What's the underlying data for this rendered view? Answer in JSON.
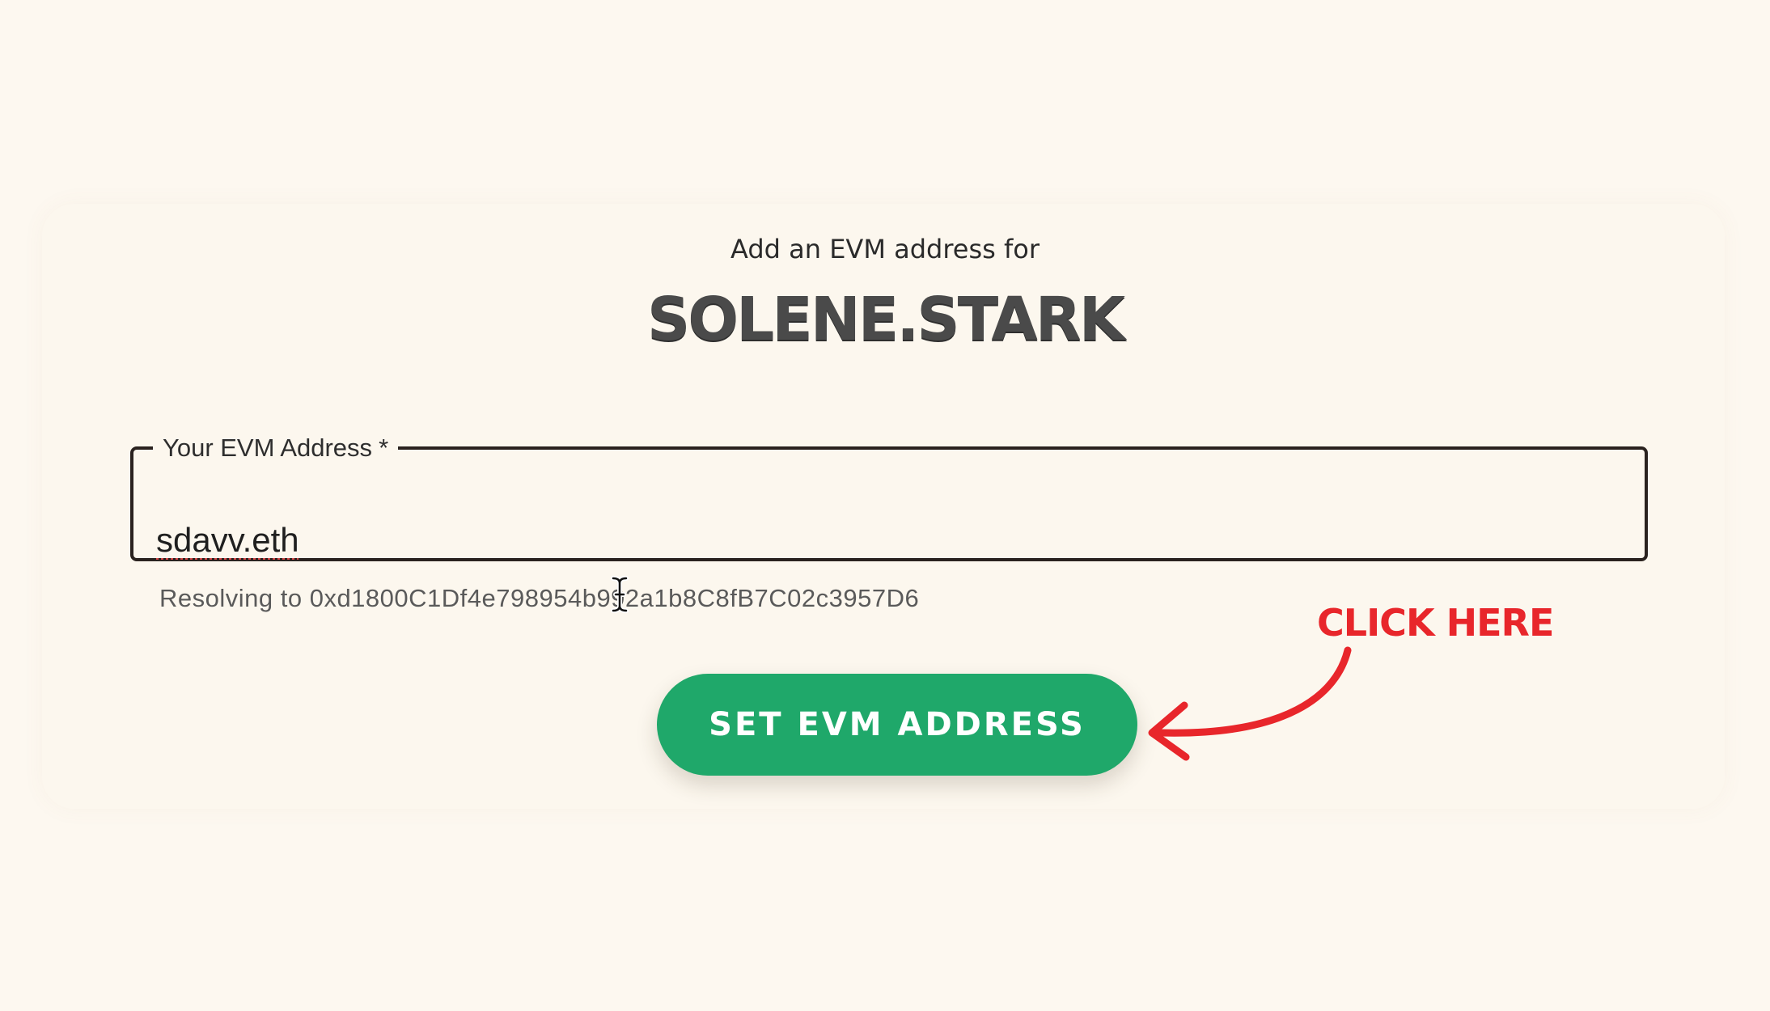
{
  "header": {
    "subtitle": "Add an EVM address for",
    "domain": "SOLENE.STARK"
  },
  "form": {
    "field_label": "Your EVM Address",
    "required_marker": "*",
    "input_value": "sdavv.eth",
    "resolving_text": "Resolving to 0xd1800C1Df4e798954b992a1b8C8fB7C02c3957D6"
  },
  "actions": {
    "set_button_label": "SET EVM ADDRESS"
  },
  "annotation": {
    "text": "CLICK HERE",
    "color": "#e8262b"
  },
  "colors": {
    "background": "#fdf8f0",
    "button": "#1fa86a",
    "border": "#2a221f"
  },
  "icons": {
    "cursor": "text-cursor-icon",
    "arrow": "curved-arrow-icon"
  }
}
